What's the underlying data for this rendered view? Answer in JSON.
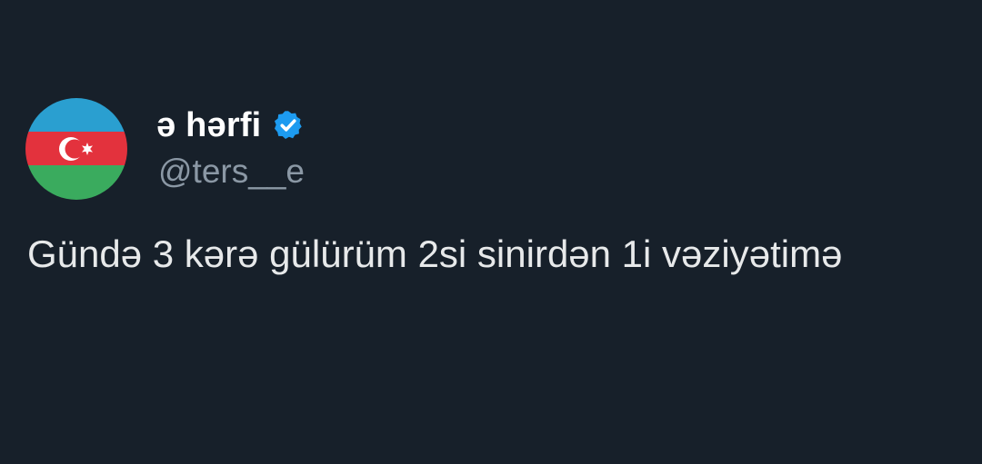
{
  "author": {
    "display_name": "ə hərfi",
    "handle": "@ters__e",
    "verified": true,
    "avatar_icon": "azerbaijan-flag-avatar",
    "verified_icon": "verified-badge-icon"
  },
  "tweet": {
    "text": "Gündə 3 kərə gülürüm 2si sinirdən 1i vəziyətimə"
  },
  "colors": {
    "background": "#17202a",
    "text_primary": "#e7e9ea",
    "text_secondary": "#8b98a5",
    "verified_blue": "#1d9bf0",
    "flag_blue": "#0098c3",
    "flag_red": "#e8323c",
    "flag_green": "#00a95c"
  }
}
